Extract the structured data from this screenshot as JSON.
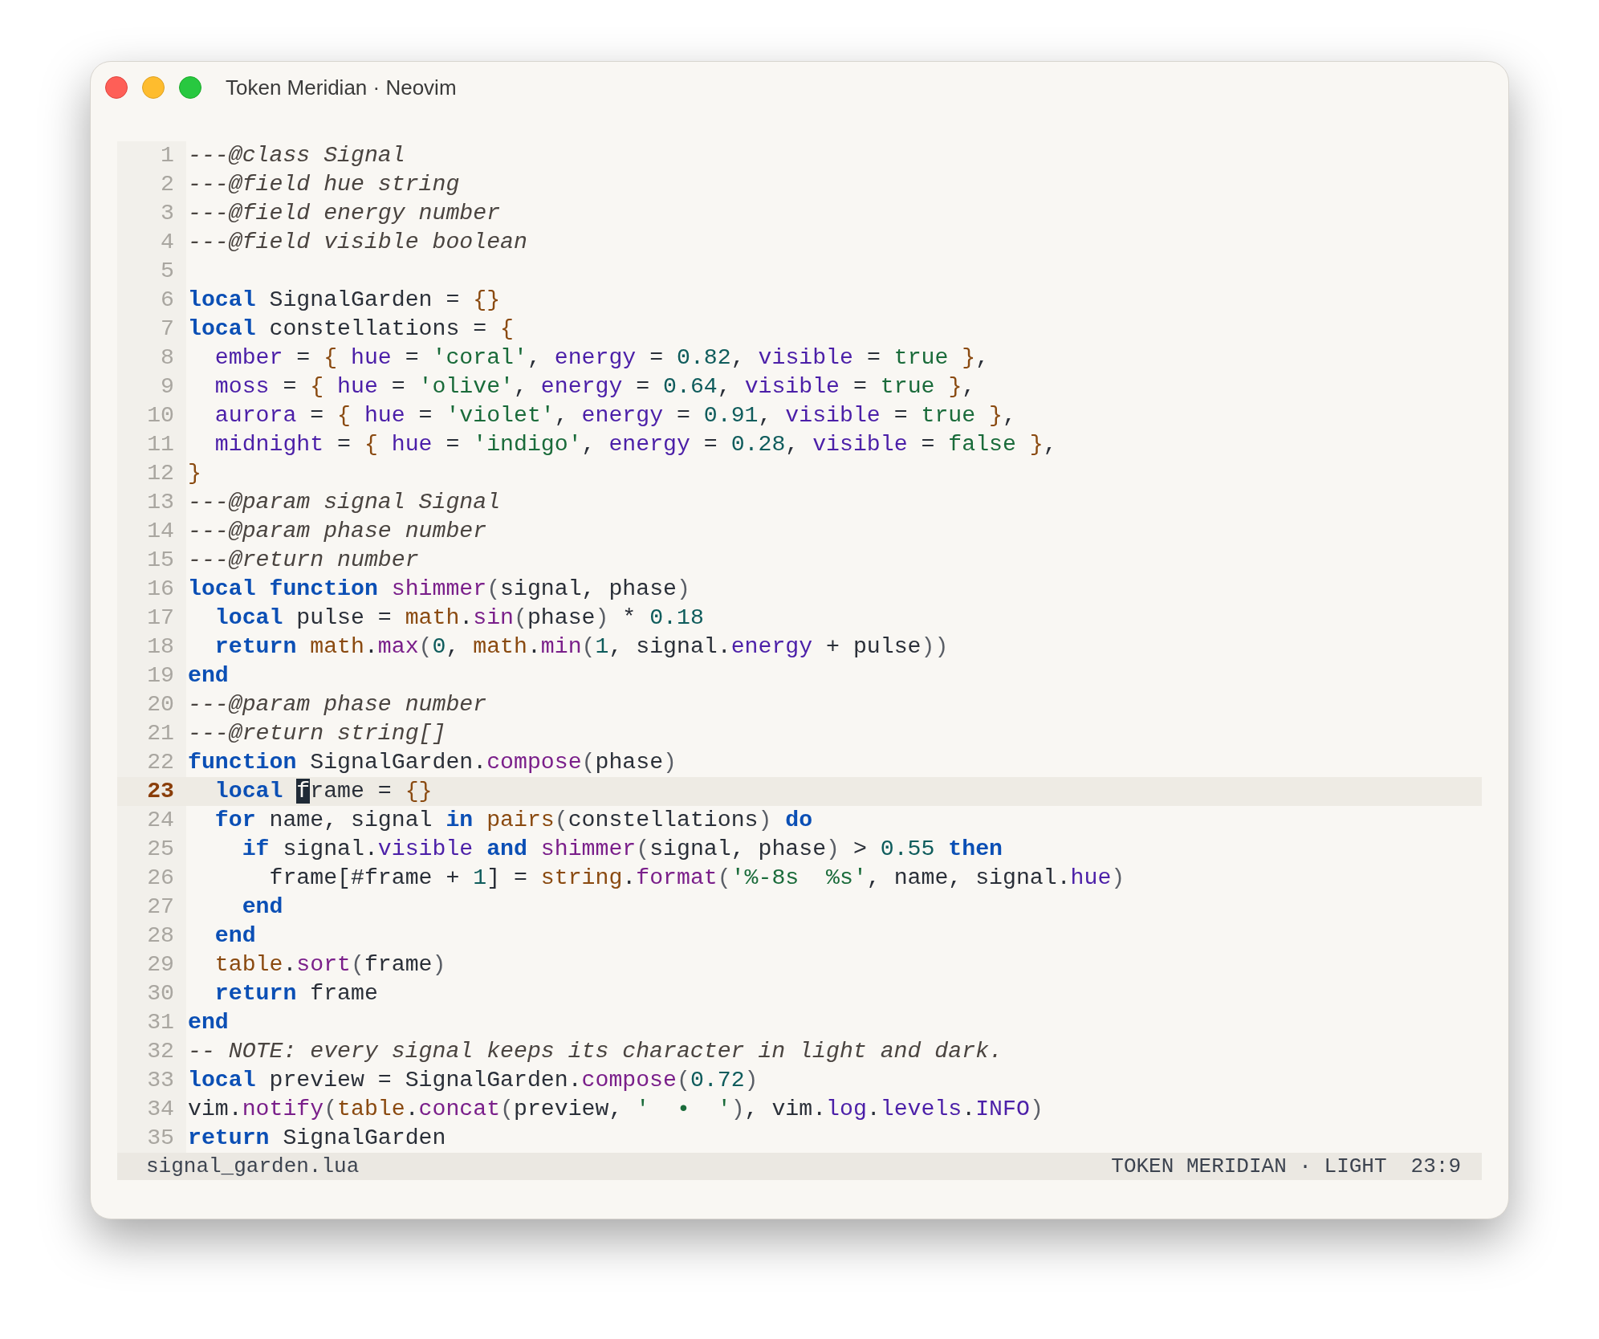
{
  "window": {
    "title": "Token Meridian · Neovim"
  },
  "lines": [
    {
      "number": "1",
      "current": false,
      "tokens": [
        {
          "kind": "comment",
          "text": "---@class Signal"
        }
      ]
    },
    {
      "number": "2",
      "current": false,
      "tokens": [
        {
          "kind": "comment",
          "text": "---@field hue string"
        }
      ]
    },
    {
      "number": "3",
      "current": false,
      "tokens": [
        {
          "kind": "comment",
          "text": "---@field energy number"
        }
      ]
    },
    {
      "number": "4",
      "current": false,
      "tokens": [
        {
          "kind": "comment",
          "text": "---@field visible boolean"
        }
      ]
    },
    {
      "number": "5",
      "current": false
    },
    {
      "number": "6",
      "current": false,
      "tokens": [
        {
          "kind": "kw",
          "text": "local"
        },
        {
          "kind": "text",
          "text": " SignalGarden = "
        },
        {
          "kind": "brace",
          "text": "{}"
        }
      ]
    },
    {
      "number": "7",
      "current": false,
      "tokens": [
        {
          "kind": "kw",
          "text": "local"
        },
        {
          "kind": "text",
          "text": " constellations = "
        },
        {
          "kind": "brace",
          "text": "{"
        }
      ]
    },
    {
      "number": "8",
      "current": false,
      "tokens": [
        {
          "kind": "field",
          "text": "  ember"
        },
        {
          "kind": "text",
          "text": " = "
        },
        {
          "kind": "brace",
          "text": "{"
        },
        {
          "kind": "field",
          "text": " hue"
        },
        {
          "kind": "text",
          "text": " = "
        },
        {
          "kind": "str",
          "text": "'coral'"
        },
        {
          "kind": "text",
          "text": ", "
        },
        {
          "kind": "field",
          "text": "energy"
        },
        {
          "kind": "text",
          "text": " = "
        },
        {
          "kind": "num",
          "text": "0.82"
        },
        {
          "kind": "text",
          "text": ", "
        },
        {
          "kind": "field",
          "text": "visible"
        },
        {
          "kind": "text",
          "text": " = "
        },
        {
          "kind": "bool",
          "text": "true"
        },
        {
          "kind": "brace",
          "text": " }"
        },
        {
          "kind": "text",
          "text": ","
        }
      ]
    },
    {
      "number": "9",
      "current": false,
      "tokens": [
        {
          "kind": "field",
          "text": "  moss"
        },
        {
          "kind": "text",
          "text": " = "
        },
        {
          "kind": "brace",
          "text": "{"
        },
        {
          "kind": "field",
          "text": " hue"
        },
        {
          "kind": "text",
          "text": " = "
        },
        {
          "kind": "str",
          "text": "'olive'"
        },
        {
          "kind": "text",
          "text": ", "
        },
        {
          "kind": "field",
          "text": "energy"
        },
        {
          "kind": "text",
          "text": " = "
        },
        {
          "kind": "num",
          "text": "0.64"
        },
        {
          "kind": "text",
          "text": ", "
        },
        {
          "kind": "field",
          "text": "visible"
        },
        {
          "kind": "text",
          "text": " = "
        },
        {
          "kind": "bool",
          "text": "true"
        },
        {
          "kind": "brace",
          "text": " }"
        },
        {
          "kind": "text",
          "text": ","
        }
      ]
    },
    {
      "number": "10",
      "current": false,
      "tokens": [
        {
          "kind": "field",
          "text": "  aurora"
        },
        {
          "kind": "text",
          "text": " = "
        },
        {
          "kind": "brace",
          "text": "{"
        },
        {
          "kind": "field",
          "text": " hue"
        },
        {
          "kind": "text",
          "text": " = "
        },
        {
          "kind": "str",
          "text": "'violet'"
        },
        {
          "kind": "text",
          "text": ", "
        },
        {
          "kind": "field",
          "text": "energy"
        },
        {
          "kind": "text",
          "text": " = "
        },
        {
          "kind": "num",
          "text": "0.91"
        },
        {
          "kind": "text",
          "text": ", "
        },
        {
          "kind": "field",
          "text": "visible"
        },
        {
          "kind": "text",
          "text": " = "
        },
        {
          "kind": "bool",
          "text": "true"
        },
        {
          "kind": "brace",
          "text": " }"
        },
        {
          "kind": "text",
          "text": ","
        }
      ]
    },
    {
      "number": "11",
      "current": false,
      "tokens": [
        {
          "kind": "field",
          "text": "  midnight"
        },
        {
          "kind": "text",
          "text": " = "
        },
        {
          "kind": "brace",
          "text": "{"
        },
        {
          "kind": "field",
          "text": " hue"
        },
        {
          "kind": "text",
          "text": " = "
        },
        {
          "kind": "str",
          "text": "'indigo'"
        },
        {
          "kind": "text",
          "text": ", "
        },
        {
          "kind": "field",
          "text": "energy"
        },
        {
          "kind": "text",
          "text": " = "
        },
        {
          "kind": "num",
          "text": "0.28"
        },
        {
          "kind": "text",
          "text": ", "
        },
        {
          "kind": "field",
          "text": "visible"
        },
        {
          "kind": "text",
          "text": " = "
        },
        {
          "kind": "bool",
          "text": "false"
        },
        {
          "kind": "brace",
          "text": " }"
        },
        {
          "kind": "text",
          "text": ","
        }
      ]
    },
    {
      "number": "12",
      "current": false,
      "tokens": [
        {
          "kind": "brace",
          "text": "}"
        }
      ]
    },
    {
      "number": "13",
      "current": false,
      "tokens": [
        {
          "kind": "comment",
          "text": "---@param signal Signal"
        }
      ]
    },
    {
      "number": "14",
      "current": false,
      "tokens": [
        {
          "kind": "comment",
          "text": "---@param phase number"
        }
      ]
    },
    {
      "number": "15",
      "current": false,
      "tokens": [
        {
          "kind": "comment",
          "text": "---@return number"
        }
      ]
    },
    {
      "number": "16",
      "current": false,
      "tokens": [
        {
          "kind": "kw",
          "text": "local function"
        },
        {
          "kind": "method",
          "text": " shimmer"
        },
        {
          "kind": "paren",
          "text": "("
        },
        {
          "kind": "text",
          "text": "signal, phase"
        },
        {
          "kind": "paren",
          "text": ")"
        }
      ]
    },
    {
      "number": "17",
      "current": false,
      "tokens": [
        {
          "kind": "kw",
          "text": "  local"
        },
        {
          "kind": "text",
          "text": " pulse = "
        },
        {
          "kind": "lib",
          "text": "math"
        },
        {
          "kind": "text",
          "text": "."
        },
        {
          "kind": "method",
          "text": "sin"
        },
        {
          "kind": "paren",
          "text": "("
        },
        {
          "kind": "text",
          "text": "phase"
        },
        {
          "kind": "paren",
          "text": ")"
        },
        {
          "kind": "text",
          "text": " * "
        },
        {
          "kind": "num",
          "text": "0.18"
        }
      ]
    },
    {
      "number": "18",
      "current": false,
      "tokens": [
        {
          "kind": "kw",
          "text": "  return"
        },
        {
          "kind": "lib",
          "text": " math"
        },
        {
          "kind": "text",
          "text": "."
        },
        {
          "kind": "method",
          "text": "max"
        },
        {
          "kind": "paren",
          "text": "("
        },
        {
          "kind": "num",
          "text": "0"
        },
        {
          "kind": "text",
          "text": ", "
        },
        {
          "kind": "lib",
          "text": "math"
        },
        {
          "kind": "text",
          "text": "."
        },
        {
          "kind": "method",
          "text": "min"
        },
        {
          "kind": "paren",
          "text": "("
        },
        {
          "kind": "num",
          "text": "1"
        },
        {
          "kind": "text",
          "text": ", signal."
        },
        {
          "kind": "field",
          "text": "energy"
        },
        {
          "kind": "text",
          "text": " + pulse"
        },
        {
          "kind": "paren",
          "text": "))"
        }
      ]
    },
    {
      "number": "19",
      "current": false,
      "tokens": [
        {
          "kind": "kw",
          "text": "end"
        }
      ]
    },
    {
      "number": "20",
      "current": false,
      "tokens": [
        {
          "kind": "comment",
          "text": "---@param phase number"
        }
      ]
    },
    {
      "number": "21",
      "current": false,
      "tokens": [
        {
          "kind": "comment",
          "text": "---@return string[]"
        }
      ]
    },
    {
      "number": "22",
      "current": false,
      "tokens": [
        {
          "kind": "kw",
          "text": "function"
        },
        {
          "kind": "text",
          "text": " SignalGarden."
        },
        {
          "kind": "method",
          "text": "compose"
        },
        {
          "kind": "paren",
          "text": "("
        },
        {
          "kind": "text",
          "text": "phase"
        },
        {
          "kind": "paren",
          "text": ")"
        }
      ]
    },
    {
      "number": "23",
      "current": true,
      "tokens": [
        {
          "kind": "kw",
          "text": "  local "
        },
        {
          "kind": "cursor",
          "text": "f"
        },
        {
          "kind": "text",
          "text": "rame = "
        },
        {
          "kind": "brace",
          "text": "{}"
        }
      ]
    },
    {
      "number": "24",
      "current": false,
      "tokens": [
        {
          "kind": "kw",
          "text": "  for"
        },
        {
          "kind": "text",
          "text": " name, signal "
        },
        {
          "kind": "kw",
          "text": "in"
        },
        {
          "kind": "lib",
          "text": " pairs"
        },
        {
          "kind": "paren",
          "text": "("
        },
        {
          "kind": "text",
          "text": "constellations"
        },
        {
          "kind": "paren",
          "text": ")"
        },
        {
          "kind": "kw",
          "text": " do"
        }
      ]
    },
    {
      "number": "25",
      "current": false,
      "tokens": [
        {
          "kind": "kw",
          "text": "    if"
        },
        {
          "kind": "text",
          "text": " signal."
        },
        {
          "kind": "field",
          "text": "visible"
        },
        {
          "kind": "kw",
          "text": " and"
        },
        {
          "kind": "method",
          "text": " shimmer"
        },
        {
          "kind": "paren",
          "text": "("
        },
        {
          "kind": "text",
          "text": "signal, phase"
        },
        {
          "kind": "paren",
          "text": ")"
        },
        {
          "kind": "text",
          "text": " > "
        },
        {
          "kind": "num",
          "text": "0.55"
        },
        {
          "kind": "kw",
          "text": " then"
        }
      ]
    },
    {
      "number": "26",
      "current": false,
      "tokens": [
        {
          "kind": "text",
          "text": "      frame[#frame + "
        },
        {
          "kind": "num",
          "text": "1"
        },
        {
          "kind": "text",
          "text": "] = "
        },
        {
          "kind": "lib",
          "text": "string"
        },
        {
          "kind": "text",
          "text": "."
        },
        {
          "kind": "method",
          "text": "format"
        },
        {
          "kind": "paren",
          "text": "("
        },
        {
          "kind": "str",
          "text": "'%-8s  %s'"
        },
        {
          "kind": "text",
          "text": ", name, signal."
        },
        {
          "kind": "field",
          "text": "hue"
        },
        {
          "kind": "paren",
          "text": ")"
        }
      ]
    },
    {
      "number": "27",
      "current": false,
      "tokens": [
        {
          "kind": "kw",
          "text": "    end"
        }
      ]
    },
    {
      "number": "28",
      "current": false,
      "tokens": [
        {
          "kind": "kw",
          "text": "  end"
        }
      ]
    },
    {
      "number": "29",
      "current": false,
      "tokens": [
        {
          "kind": "lib",
          "text": "  table"
        },
        {
          "kind": "text",
          "text": "."
        },
        {
          "kind": "method",
          "text": "sort"
        },
        {
          "kind": "paren",
          "text": "("
        },
        {
          "kind": "text",
          "text": "frame"
        },
        {
          "kind": "paren",
          "text": ")"
        }
      ]
    },
    {
      "number": "30",
      "current": false,
      "tokens": [
        {
          "kind": "kw",
          "text": "  return"
        },
        {
          "kind": "text",
          "text": " frame"
        }
      ]
    },
    {
      "number": "31",
      "current": false,
      "tokens": [
        {
          "kind": "kw",
          "text": "end"
        }
      ]
    },
    {
      "number": "32",
      "current": false,
      "tokens": [
        {
          "kind": "comment",
          "text": "-- NOTE: every signal keeps its character in light and dark."
        }
      ]
    },
    {
      "number": "33",
      "current": false,
      "tokens": [
        {
          "kind": "kw",
          "text": "local"
        },
        {
          "kind": "text",
          "text": " preview = SignalGarden."
        },
        {
          "kind": "method",
          "text": "compose"
        },
        {
          "kind": "paren",
          "text": "("
        },
        {
          "kind": "num",
          "text": "0.72"
        },
        {
          "kind": "paren",
          "text": ")"
        }
      ]
    },
    {
      "number": "34",
      "current": false,
      "tokens": [
        {
          "kind": "text",
          "text": "vim."
        },
        {
          "kind": "method",
          "text": "notify"
        },
        {
          "kind": "paren",
          "text": "("
        },
        {
          "kind": "lib",
          "text": "table"
        },
        {
          "kind": "text",
          "text": "."
        },
        {
          "kind": "method",
          "text": "concat"
        },
        {
          "kind": "paren",
          "text": "("
        },
        {
          "kind": "text",
          "text": "preview, "
        },
        {
          "kind": "str",
          "text": "'  •  '"
        },
        {
          "kind": "paren",
          "text": ")"
        },
        {
          "kind": "text",
          "text": ", vim."
        },
        {
          "kind": "field",
          "text": "log"
        },
        {
          "kind": "text",
          "text": "."
        },
        {
          "kind": "field",
          "text": "levels"
        },
        {
          "kind": "text",
          "text": "."
        },
        {
          "kind": "field",
          "text": "INFO"
        },
        {
          "kind": "paren",
          "text": ")"
        }
      ]
    },
    {
      "number": "35",
      "current": false,
      "tokens": [
        {
          "kind": "kw",
          "text": "return"
        },
        {
          "kind": "text",
          "text": " SignalGarden"
        }
      ]
    }
  ],
  "status_bar": {
    "file": "signal_garden.lua",
    "theme": "TOKEN MERIDIAN · LIGHT",
    "position": "23:9"
  }
}
